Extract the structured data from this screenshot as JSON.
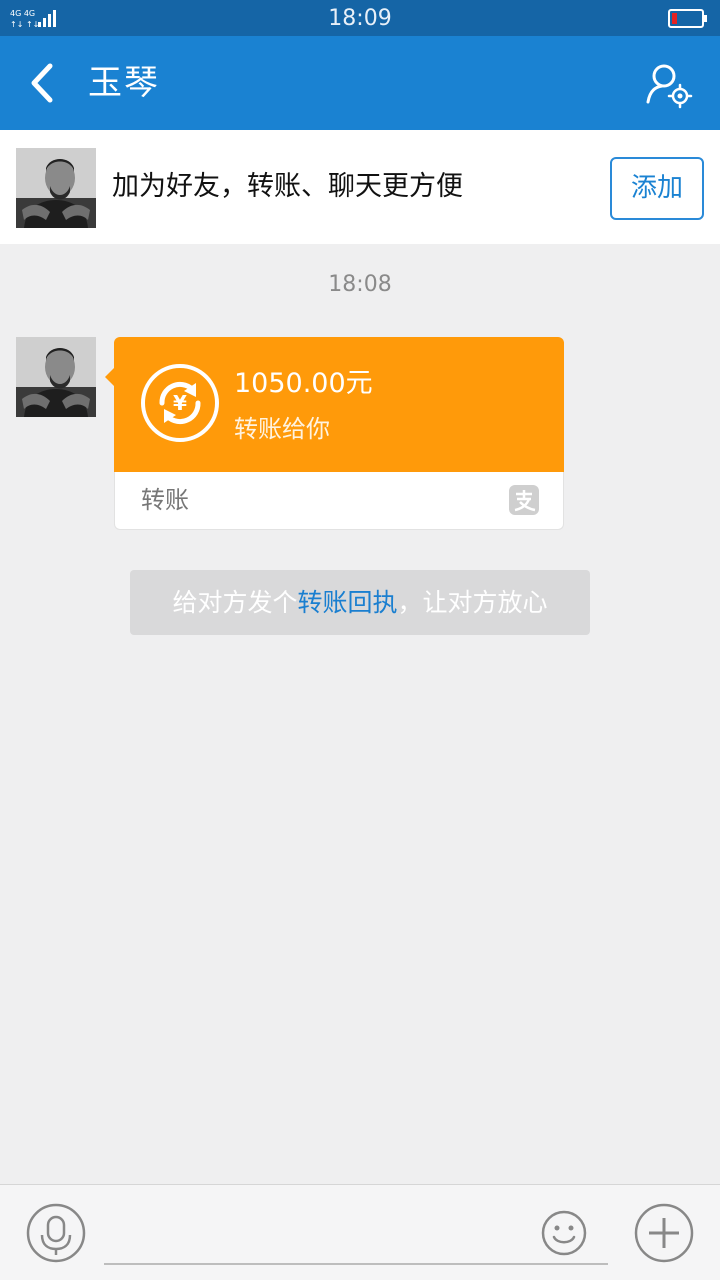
{
  "status_bar": {
    "network": "4G 4G",
    "time": "18:09"
  },
  "header": {
    "title": "玉琴",
    "back_icon": "chevron-left-icon",
    "settings_icon": "user-settings-icon"
  },
  "friend_banner": {
    "text": "加为好友，转账、聊天更方便",
    "add_label": "添加"
  },
  "messages": {
    "timestamp": "18:08",
    "transfer": {
      "amount": "1050.00元",
      "description": "转账给你",
      "footer_label": "转账",
      "icon": "yuan-transfer-icon",
      "brand_icon": "alipay-icon",
      "accent_color": "#ff9a0a"
    },
    "tip": {
      "prefix": "给对方发个",
      "link": "转账回执",
      "suffix": "，让对方放心"
    }
  },
  "input_bar": {
    "voice_icon": "microphone-icon",
    "emoji_icon": "smiley-icon",
    "plus_icon": "plus-icon",
    "input_value": ""
  },
  "colors": {
    "header": "#1a82d2",
    "status_bar": "#1565a6",
    "link": "#1a7fd0",
    "background": "#efeff0"
  }
}
